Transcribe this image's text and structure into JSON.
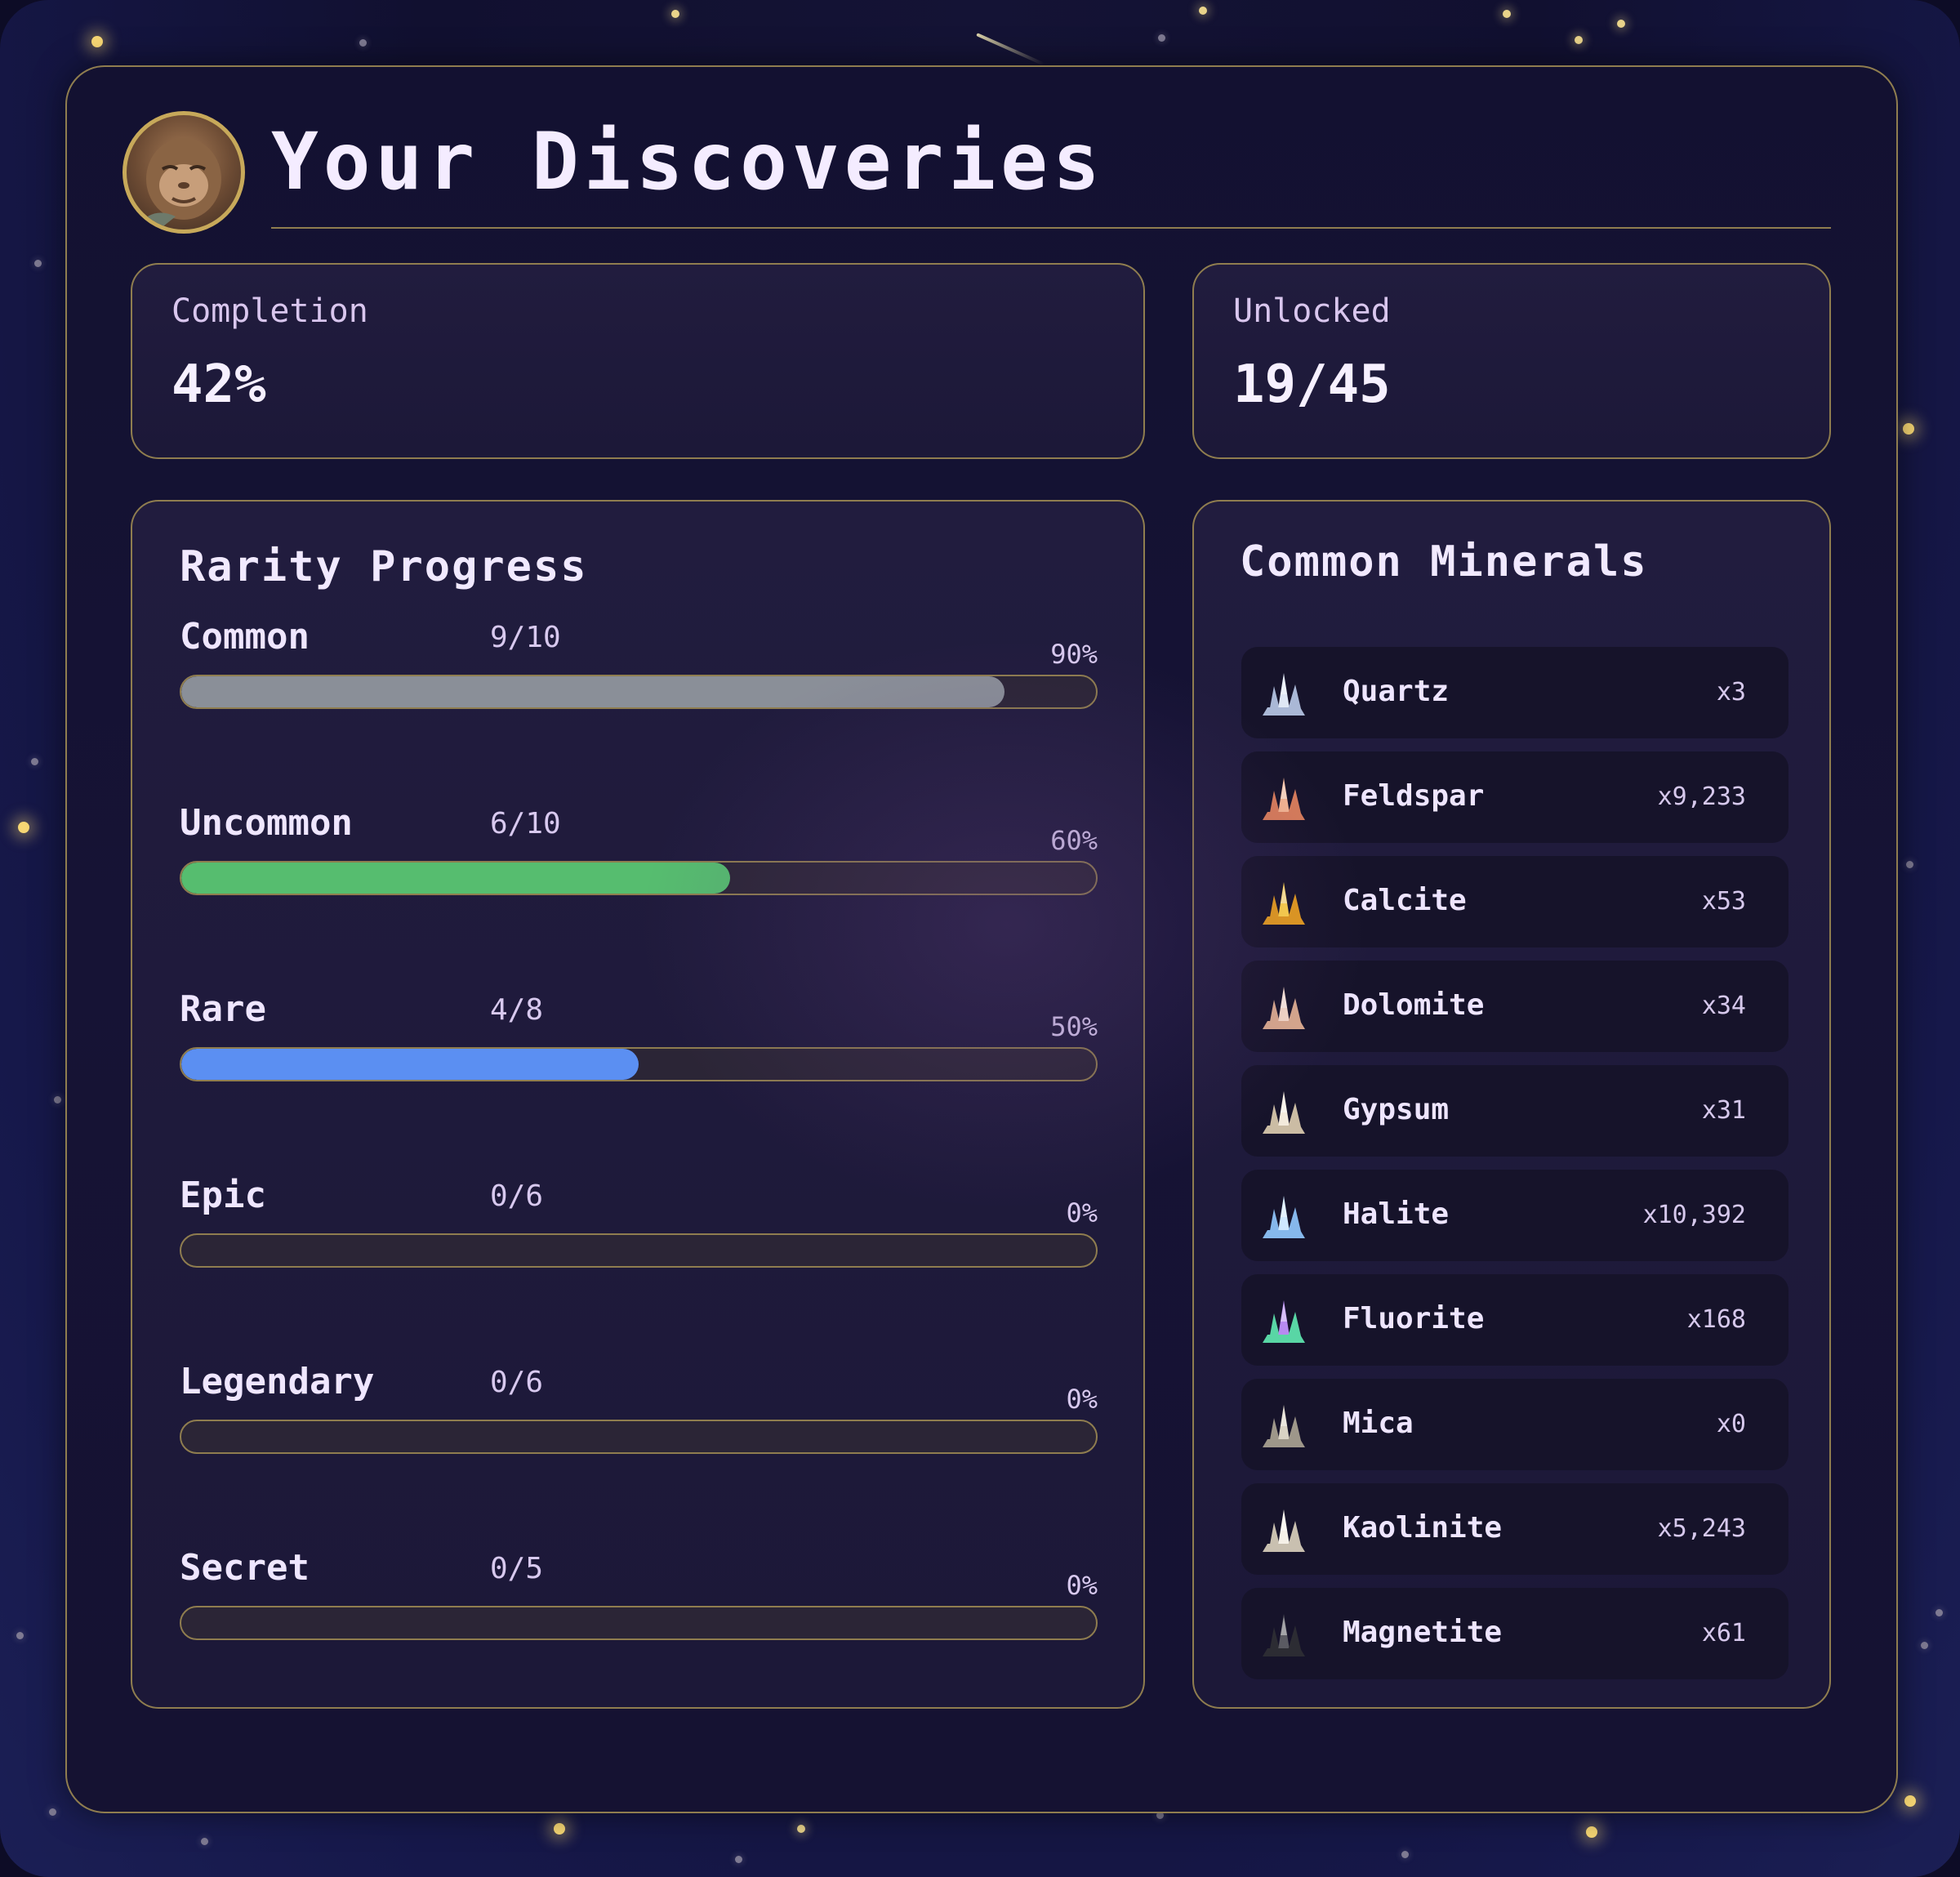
{
  "page": {
    "title": "Your Discoveries",
    "avatar_icon": "monkey-avatar"
  },
  "stats": {
    "completion": {
      "label": "Completion",
      "value": "42%"
    },
    "unlocked": {
      "label": "Unlocked",
      "value": "19/45"
    }
  },
  "rarity": {
    "title": "Rarity Progress",
    "items": [
      {
        "name": "Common",
        "count": "9/10",
        "percent_label": "90%",
        "percent": 90,
        "color": "#8a8f98"
      },
      {
        "name": "Uncommon",
        "count": "6/10",
        "percent_label": "60%",
        "percent": 60,
        "color": "#56bd6f"
      },
      {
        "name": "Rare",
        "count": "4/8",
        "percent_label": "50%",
        "percent": 50,
        "color": "#5b8ff2"
      },
      {
        "name": "Epic",
        "count": "0/6",
        "percent_label": "0%",
        "percent": 0,
        "color": "#a06ae0"
      },
      {
        "name": "Legendary",
        "count": "0/6",
        "percent_label": "0%",
        "percent": 0,
        "color": "#e6b04c"
      },
      {
        "name": "Secret",
        "count": "0/5",
        "percent_label": "0%",
        "percent": 0,
        "color": "#e05c8a"
      }
    ]
  },
  "minerals": {
    "title": "Common Minerals",
    "items": [
      {
        "name": "Quartz",
        "qty": "x3",
        "icon": "quartz-crystal-icon",
        "colors": [
          "#dfe7f5",
          "#aab8d6"
        ]
      },
      {
        "name": "Feldspar",
        "qty": "x9,233",
        "icon": "feldspar-icon",
        "colors": [
          "#f3b491",
          "#d77c5a"
        ]
      },
      {
        "name": "Calcite",
        "qty": "x53",
        "icon": "calcite-crystal-icon",
        "colors": [
          "#ffd34a",
          "#e39b1e"
        ]
      },
      {
        "name": "Dolomite",
        "qty": "x34",
        "icon": "dolomite-icon",
        "colors": [
          "#f6d9c8",
          "#d9a98d"
        ]
      },
      {
        "name": "Gypsum",
        "qty": "x31",
        "icon": "gypsum-crystal-icon",
        "colors": [
          "#f3eadc",
          "#cbbca4"
        ]
      },
      {
        "name": "Halite",
        "qty": "x10,392",
        "icon": "halite-cube-icon",
        "colors": [
          "#cfe8ff",
          "#86b8ec"
        ]
      },
      {
        "name": "Fluorite",
        "qty": "x168",
        "icon": "fluorite-icon",
        "colors": [
          "#b78af0",
          "#59d6a5"
        ]
      },
      {
        "name": "Mica",
        "qty": "x0",
        "icon": "mica-sheet-icon",
        "colors": [
          "#d9d2c4",
          "#9e978a"
        ]
      },
      {
        "name": "Kaolinite",
        "qty": "x5,243",
        "icon": "kaolinite-pile-icon",
        "colors": [
          "#f6f1e8",
          "#c9c0b0"
        ]
      },
      {
        "name": "Magnetite",
        "qty": "x61",
        "icon": "magnetite-icon",
        "colors": [
          "#5a5a62",
          "#2c2c33"
        ]
      }
    ]
  }
}
